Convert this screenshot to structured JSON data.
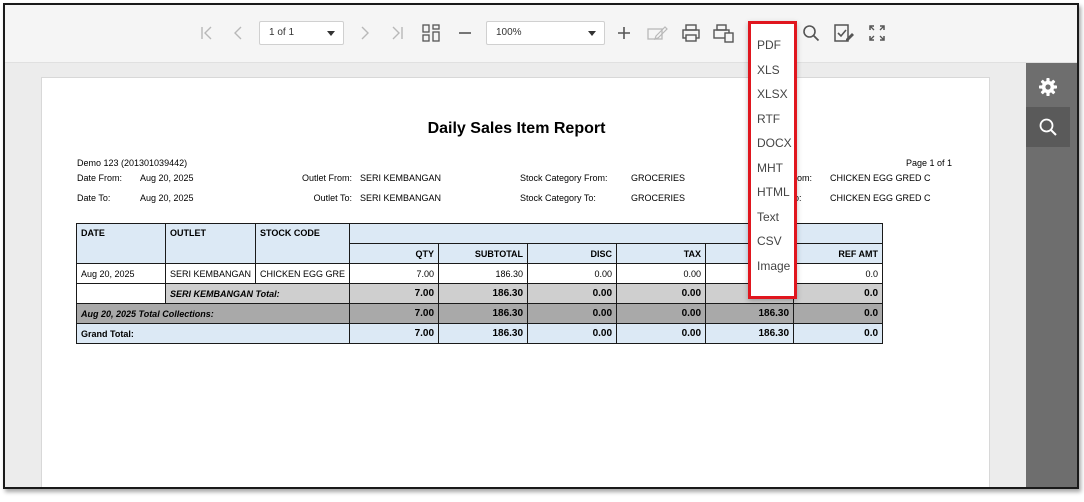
{
  "toolbar": {
    "page_select": "1 of 1",
    "zoom_select": "100%"
  },
  "export_menu": {
    "items": [
      "PDF",
      "XLS",
      "XLSX",
      "RTF",
      "DOCX",
      "MHT",
      "HTML",
      "Text",
      "CSV",
      "Image"
    ]
  },
  "report": {
    "title": "Daily Sales Item Report",
    "company": "Demo 123 (201301039442)",
    "page_info": "Page 1 of 1",
    "date_from_label": "Date From:",
    "date_from": "Aug 20, 2025",
    "date_to_label": "Date To:",
    "date_to": "Aug 20, 2025",
    "outlet_from_label": "Outlet From:",
    "outlet_from": "SERI KEMBANGAN",
    "outlet_to_label": "Outlet To:",
    "outlet_to": "SERI KEMBANGAN",
    "stock_cat_from_label": "Stock Category From:",
    "stock_cat_from": "GROCERIES",
    "stock_cat_to_label": "Stock Category To:",
    "stock_cat_to": "GROCERIES",
    "stock_from_label_partial": "rom:",
    "stock_from": "CHICKEN EGG GRED C",
    "stock_to_label_partial": "o:",
    "stock_to": "CHICKEN EGG GRED C",
    "columns": {
      "date": "DATE",
      "outlet": "OUTLET",
      "stock_code": "STOCK CODE",
      "qty": "QTY",
      "subtotal": "SUBTOTAL",
      "disc": "DISC",
      "tax": "TAX",
      "ref_amt": "REF AMT"
    },
    "row": {
      "date": "Aug 20, 2025",
      "outlet": "SERI KEMBANGAN",
      "stock_code": "CHICKEN EGG GRE",
      "qty": "7.00",
      "subtotal": "186.30",
      "disc": "0.00",
      "tax": "0.00",
      "ref_amt": "0.0"
    },
    "outlet_total": {
      "label": "SERI KEMBANGAN Total:",
      "qty": "7.00",
      "subtotal": "186.30",
      "disc": "0.00",
      "tax": "0.00",
      "ref_amt": "0.0"
    },
    "collections": {
      "label": "Aug 20, 2025 Total Collections:",
      "qty": "7.00",
      "subtotal": "186.30",
      "disc": "0.00",
      "tax": "0.00",
      "amount": "186.30",
      "ref_amt": "0.0"
    },
    "grand_total": {
      "label": "Grand Total:",
      "qty": "7.00",
      "subtotal": "186.30",
      "disc": "0.00",
      "tax": "0.00",
      "amount": "186.30",
      "ref_amt": "0.0"
    }
  },
  "icons": {
    "first": "first-page-icon",
    "prev": "prev-page-icon",
    "next": "next-page-icon",
    "last": "last-page-icon",
    "multipage": "multi-page-view-icon",
    "zoom_out": "zoom-out-icon",
    "zoom_in": "zoom-in-icon",
    "editing": "editing-fields-icon",
    "print": "print-icon",
    "print_page": "print-page-icon",
    "export": "export-icon",
    "search": "search-icon",
    "design": "design-icon",
    "fullscreen": "fullscreen-icon",
    "settings": "gear-icon"
  },
  "colors": {
    "highlight": "#e0161e",
    "header_fill": "#dce9f5",
    "sidebar": "#6e6e6e"
  }
}
